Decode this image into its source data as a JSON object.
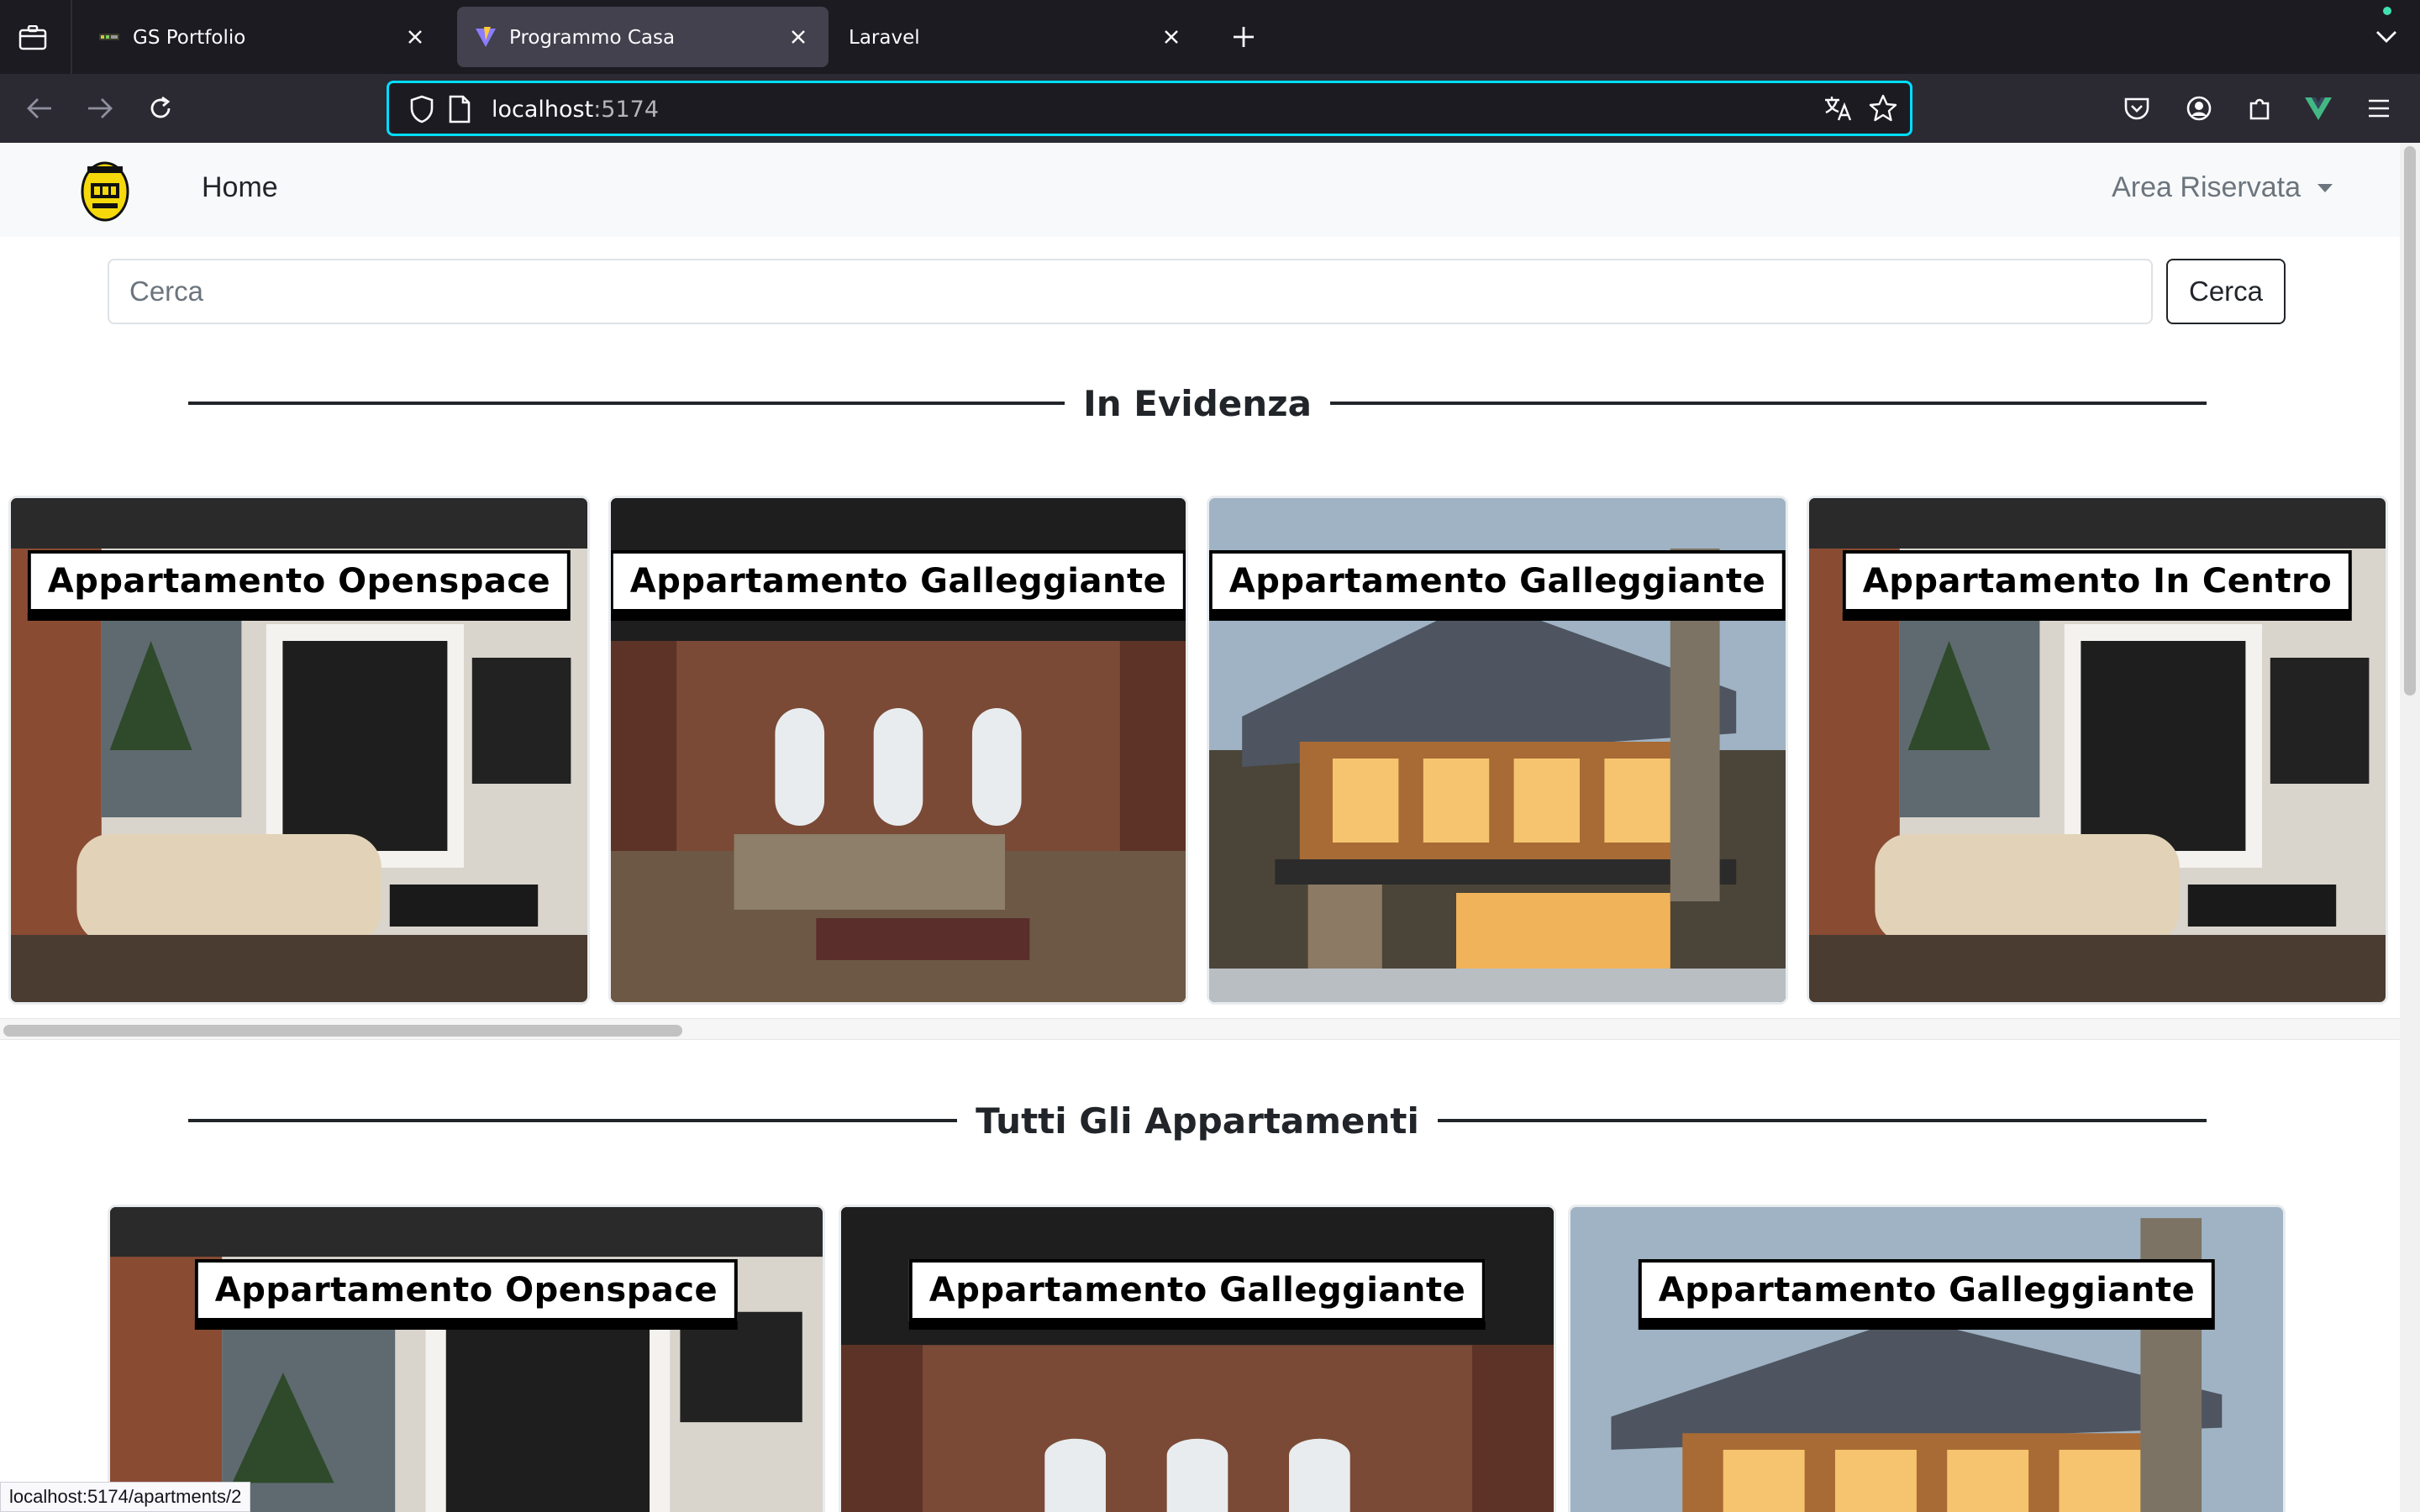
{
  "browser": {
    "tabs": [
      {
        "title": "GS Portfolio",
        "active": false
      },
      {
        "title": "Programmo Casa",
        "active": true
      },
      {
        "title": "Laravel",
        "active": false
      }
    ],
    "url": {
      "host": "localhost",
      "port": ":5174"
    },
    "status_link": "localhost:5174/apartments/2",
    "accent_color": "#00ddff"
  },
  "site": {
    "nav": {
      "logo": "abad-logo",
      "home_label": "Home",
      "area_label": "Area Riservata"
    },
    "search": {
      "placeholder": "Cerca",
      "button_label": "Cerca"
    },
    "featured": {
      "title": "In Evidenza",
      "cards": [
        {
          "name": "Appartamento Openspace",
          "photo": "white-loft-interior"
        },
        {
          "name": "Appartamento Galleggiante",
          "photo": "brick-loft-interior"
        },
        {
          "name": "Appartamento Galleggiante",
          "photo": "wooden-chalet-exterior"
        },
        {
          "name": "Appartamento In Centro",
          "photo": "white-loft-interior"
        }
      ]
    },
    "all": {
      "title": "Tutti Gli Appartamenti",
      "cards": [
        {
          "name": "Appartamento Openspace",
          "photo": "white-loft-interior"
        },
        {
          "name": "Appartamento Galleggiante",
          "photo": "brick-loft-interior"
        },
        {
          "name": "Appartamento Galleggiante",
          "photo": "wooden-chalet-exterior"
        }
      ]
    }
  }
}
